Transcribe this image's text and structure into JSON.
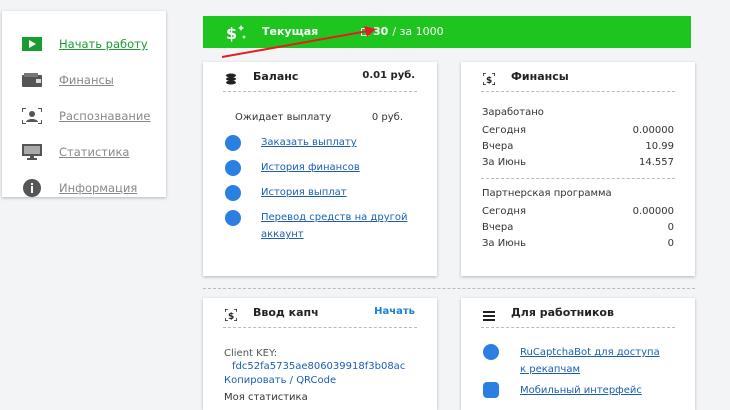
{
  "sidebar": {
    "items": [
      {
        "label": "Начать работу",
        "icon": "play-icon",
        "active": true
      },
      {
        "label": "Финансы",
        "icon": "wallet-icon"
      },
      {
        "label": "Распознавание",
        "icon": "recognition-icon"
      },
      {
        "label": "Статистика",
        "icon": "monitor-icon"
      },
      {
        "label": "Информация",
        "icon": "info-icon"
      }
    ]
  },
  "topbar": {
    "title": "Текущая",
    "count": "30",
    "total": "/ за 1000",
    "color": "#1fc51f"
  },
  "balance": {
    "title": "Баланс",
    "amount": "0.01 руб.",
    "pending_label": "Ожидает выплату",
    "pending_value": "0 руб.",
    "links": [
      {
        "label": "Заказать выплату"
      },
      {
        "label": "История финансов"
      },
      {
        "label": "История выплат"
      },
      {
        "label": "Перевод средств на другой",
        "label2": "аккаунт"
      }
    ]
  },
  "finance": {
    "title": "Финансы",
    "earned_title": "Заработано",
    "earned": [
      {
        "label": "Сегодня",
        "value": "0.00000"
      },
      {
        "label": "Вчера",
        "value": "10.99"
      },
      {
        "label": "За Июнь",
        "value": "14.557"
      }
    ],
    "partner_title": "Партнерская программа",
    "partner": [
      {
        "label": "Сегодня",
        "value": "0.00000"
      },
      {
        "label": "Вчера",
        "value": "0"
      },
      {
        "label": "За Июнь",
        "value": "0"
      }
    ]
  },
  "captcha": {
    "title": "Ввод капч",
    "start_label": "Начать",
    "client_key_label": "Client KEY:",
    "client_key_value": "fdc52fa5735ae806039918f3b08ac",
    "copy_label": "Копировать / QRCode",
    "my_stats_label": "Моя статистика"
  },
  "workers": {
    "title": "Для работников",
    "links": [
      {
        "label": "RuCaptchaBot для доступа",
        "label2": "к рекапчам"
      },
      {
        "label": "Мобильный интерфейс"
      }
    ]
  },
  "colors": {
    "accent_green": "#1a9c32",
    "link_blue": "#1a5fb4",
    "icon_blue": "#2b7fe0",
    "arrow_red": "#e02020"
  }
}
